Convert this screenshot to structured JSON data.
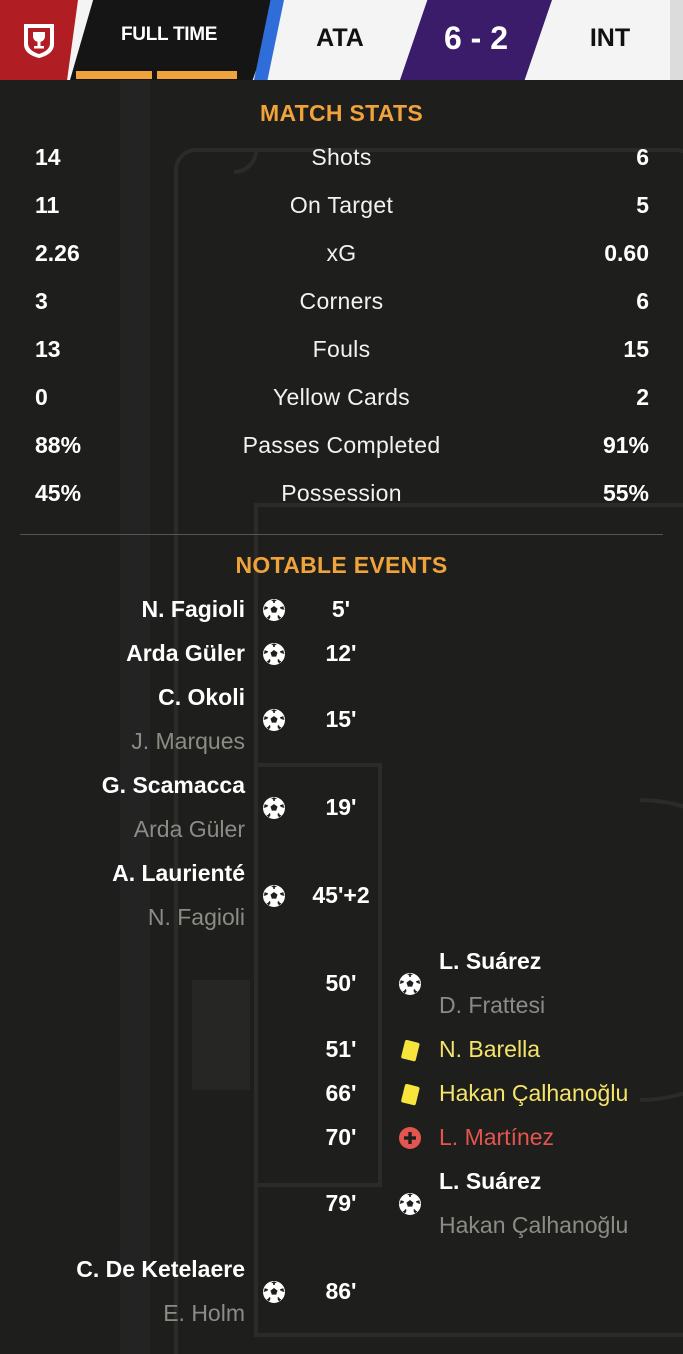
{
  "header": {
    "status": "FULL TIME",
    "home_team": "ATA",
    "score": "6 - 2",
    "away_team": "INT",
    "colors": {
      "accent": "#f0a23b",
      "brand_red": "#b01d22",
      "score_bg": "#3b1c6b",
      "stripe_blue": "#2f6ed8"
    }
  },
  "stats": {
    "title": "MATCH STATS",
    "rows": [
      {
        "home": "14",
        "label": "Shots",
        "away": "6"
      },
      {
        "home": "11",
        "label": "On Target",
        "away": "5"
      },
      {
        "home": "2.26",
        "label": "xG",
        "away": "0.60"
      },
      {
        "home": "3",
        "label": "Corners",
        "away": "6"
      },
      {
        "home": "13",
        "label": "Fouls",
        "away": "15"
      },
      {
        "home": "0",
        "label": "Yellow Cards",
        "away": "2"
      },
      {
        "home": "88%",
        "label": "Passes Completed",
        "away": "91%"
      },
      {
        "home": "45%",
        "label": "Possession",
        "away": "55%"
      }
    ]
  },
  "events": {
    "title": "NOTABLE EVENTS",
    "items": [
      {
        "side": "home",
        "type": "goal",
        "minute": "5'",
        "player": "N. Fagioli",
        "assist": ""
      },
      {
        "side": "home",
        "type": "goal",
        "minute": "12'",
        "player": "Arda Güler",
        "assist": ""
      },
      {
        "side": "home",
        "type": "goal",
        "minute": "15'",
        "player": "C. Okoli",
        "assist": "J. Marques"
      },
      {
        "side": "home",
        "type": "goal",
        "minute": "19'",
        "player": "G. Scamacca",
        "assist": "Arda Güler"
      },
      {
        "side": "home",
        "type": "goal",
        "minute": "45'+2",
        "player": "A. Laurienté",
        "assist": "N. Fagioli"
      },
      {
        "side": "away",
        "type": "goal",
        "minute": "50'",
        "player": "L. Suárez",
        "assist": "D. Frattesi"
      },
      {
        "side": "away",
        "type": "yellow-card",
        "minute": "51'",
        "player": "N. Barella",
        "assist": ""
      },
      {
        "side": "away",
        "type": "yellow-card",
        "minute": "66'",
        "player": "Hakan Çalhanoğlu",
        "assist": ""
      },
      {
        "side": "away",
        "type": "injury",
        "minute": "70'",
        "player": "L. Martínez",
        "assist": ""
      },
      {
        "side": "away",
        "type": "goal",
        "minute": "79'",
        "player": "L. Suárez",
        "assist": "Hakan Çalhanoğlu"
      },
      {
        "side": "home",
        "type": "goal",
        "minute": "86'",
        "player": "C. De Ketelaere",
        "assist": "E. Holm"
      }
    ]
  },
  "icons": {
    "logo": "trophy-shield-icon",
    "goal": "football-icon",
    "yellow": "yellow-card-icon",
    "injury": "injury-cross-icon"
  }
}
